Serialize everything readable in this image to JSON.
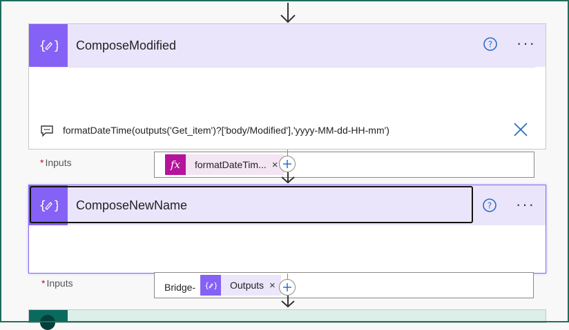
{
  "steps": [
    {
      "title": "ComposeModified",
      "expression": "formatDateTime(outputs('Get_item')?['body/Modified'],'yyyy-MM-dd-HH-mm')",
      "required_mark": "*",
      "inputs_label": "Inputs",
      "token_label": "formatDateTim...",
      "token_close": "×",
      "more": "···"
    },
    {
      "title": "ComposeNewName",
      "required_mark": "*",
      "inputs_label": "Inputs",
      "input_prefix": "Bridge-",
      "token_label": "Outputs",
      "token_close": "×",
      "more": "···"
    }
  ],
  "colors": {
    "compose_accent": "#8561f5",
    "header_bg": "#ebe5fb",
    "expression_token": "#b4149b",
    "link_blue": "#2b6cc4",
    "frame": "#1c6e5c"
  },
  "icons": [
    "arrow-down-icon",
    "compose-icon",
    "help-icon",
    "more-icon",
    "comment-icon",
    "close-icon",
    "fx-icon",
    "plus-icon"
  ]
}
